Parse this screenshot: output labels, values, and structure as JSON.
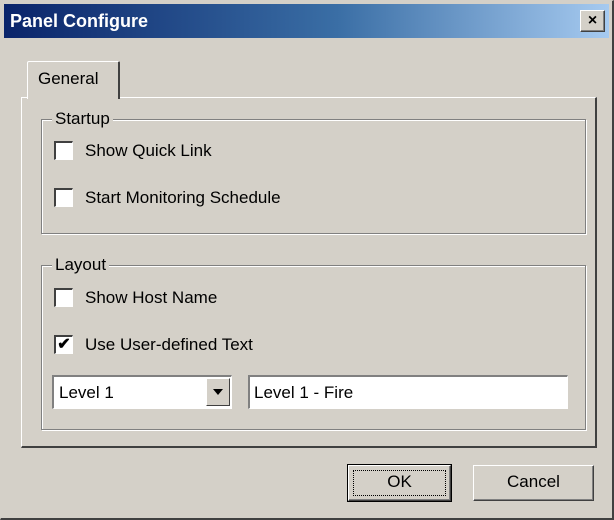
{
  "window": {
    "title": "Panel Configure",
    "close_glyph": "×",
    "close_icon": "close-icon"
  },
  "tabs": [
    {
      "label": "General",
      "selected": true
    }
  ],
  "startup": {
    "label": "Startup",
    "show_quick_link": {
      "label": "Show Quick Link",
      "checked": false
    },
    "start_monitoring_schedule": {
      "label": "Start Monitoring Schedule",
      "checked": false
    }
  },
  "layout": {
    "label": "Layout",
    "show_host_name": {
      "label": "Show Host Name",
      "checked": false
    },
    "use_user_defined_text": {
      "label": "Use User-defined Text",
      "checked": true,
      "mark": "✔"
    },
    "level_select": {
      "value": "Level 1",
      "icon": "chevron-down-icon"
    },
    "text_value": "Level 1 - Fire"
  },
  "buttons": {
    "ok": "OK",
    "cancel": "Cancel"
  }
}
